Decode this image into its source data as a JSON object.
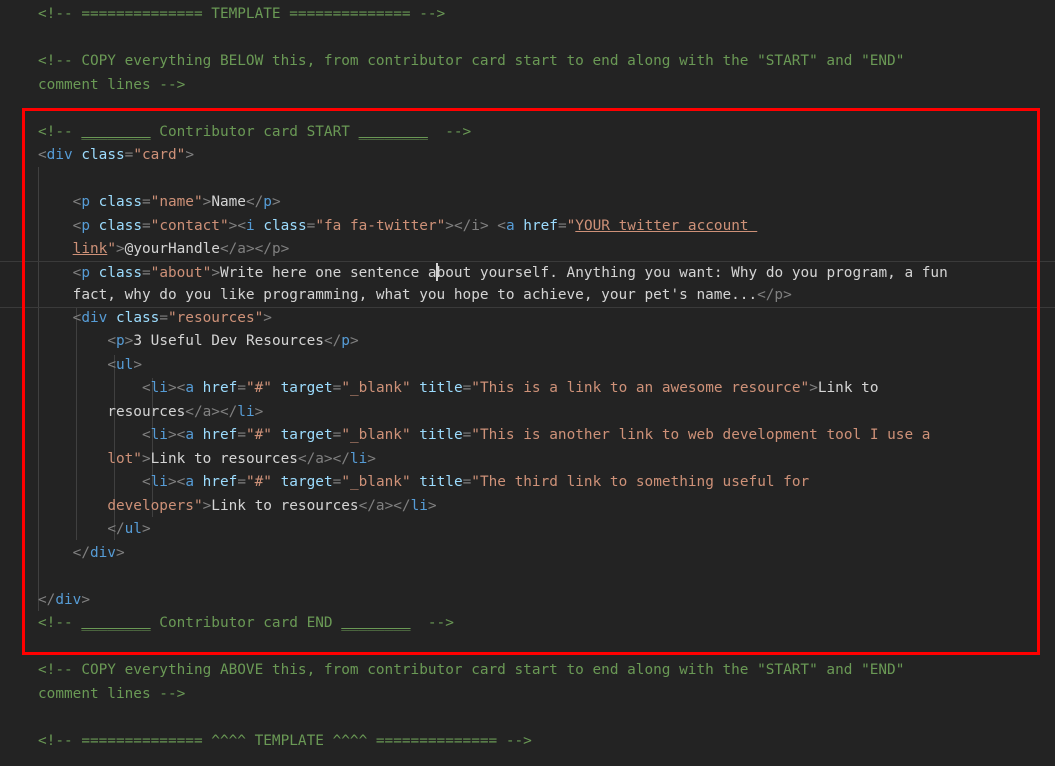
{
  "editor": {
    "background_color": "#232323",
    "default_text_color": "#d4d4d4",
    "comment_color": "#6a9955",
    "tag_color": "#569cd6",
    "attribute_color": "#9cdcfe",
    "string_color": "#ce9178",
    "punctuation_color": "#808080",
    "annotation_box_color": "#ff0000",
    "current_line_border_color": "#3a3a3a"
  },
  "lines": {
    "l1_template_header": "<!-- ============== TEMPLATE ============== -->",
    "l3_copy_below_a": "<!-- COPY everything BELOW this, from contributor card start to end along with the \"START\" and \"END\"",
    "l3_copy_below_b": "comment lines -->",
    "l5_card_start_pre": "<!-- ",
    "l5_card_start_u1": "________",
    "l5_card_start_mid": " Contributor card START ",
    "l5_card_start_u2": "________",
    "l5_card_start_post": "  -->",
    "l6_div_open_p1": "<",
    "l6_div_open_tag": "div",
    "l6_div_open_attr": " class",
    "l6_div_open_eq": "=",
    "l6_div_open_str": "\"card\"",
    "l6_div_open_p2": ">",
    "l8_name_indent": "    ",
    "l8_p_open": "<",
    "l8_p_tag": "p",
    "l8_p_attr": " class",
    "l8_p_eq": "=",
    "l8_p_str": "\"name\"",
    "l8_p_gt": ">",
    "l8_p_text": "Name",
    "l8_p_close": "</",
    "l8_p_closetag": "p",
    "l8_p_closegt": ">",
    "l9_contact_p_str": "\"contact\"",
    "l9_i_open": "<",
    "l9_i_tag": "i",
    "l9_i_attr": " class",
    "l9_i_str": "\"fa fa-twitter\"",
    "l9_i_close": "</i>",
    "l9_a_open": "<",
    "l9_a_tag": "a",
    "l9_a_attr": " href",
    "l9_a_str_open": "\"",
    "l9_a_href_value_part1": "YOUR twitter account ",
    "l9_a_href_value_part2": "link",
    "l9_a_str_close": "\"",
    "l9_a_gt": ">",
    "l9_a_text": "@yourHandle",
    "l9_a_close": "</a>",
    "l9_p_close": "</p>",
    "l10_about_str": "\"about\"",
    "l10_about_text_a": "Write here one sentence a",
    "l10_about_text_b": "bout yourself. Anything you want: Why do you program, a fun",
    "l10_about_text_c": "fact, why do you like programming, what you hope to achieve, your pet's name...",
    "l10_about_close": "</p>",
    "l11_div_resources_str": "\"resources\"",
    "l12_p3_text": "3 Useful Dev Resources",
    "l13_ul_tag": "ul",
    "l14_li_tag": "li",
    "l14_href_str": "\"#\"",
    "l14_target_attr": " target",
    "l14_target_str": "\"_blank\"",
    "l14_title_attr": " title",
    "l14_title_str_1": "\"This is a link to an awesome resource\"",
    "l14_link_text_1a": "Link to",
    "l14_link_text_1b": "resources",
    "l15_title_str_2": "\"This is another link to web development tool I use a",
    "l15_title_str_2b": "lot\"",
    "l15_link_text_2": "Link to resources",
    "l16_title_str_3": "\"The third link to something useful for",
    "l16_title_str_3b": "developers\"",
    "l16_link_text_3": "Link to resources",
    "l17_ul_close": "</ul>",
    "l18_div_close_inner": "</div>",
    "l20_div_close_outer": "</div>",
    "l21_card_end_pre": "<!-- ",
    "l21_card_end_u1": "________",
    "l21_card_end_mid": " Contributor card END ",
    "l21_card_end_u2": "________",
    "l21_card_end_post": "  -->",
    "l23_copy_above_a": "<!-- COPY everything ABOVE this, from contributor card start to end along with the \"START\" and \"END\"",
    "l23_copy_above_b": "comment lines -->",
    "l25_template_footer": "<!-- ============== ^^^^ TEMPLATE ^^^^ ============== -->"
  },
  "tokens": {
    "lt": "<",
    "gt": ">",
    "close_lt": "</",
    "eq": "=",
    "a_tag": "a",
    "p_tag": "p",
    "i_tag": "i",
    "li_tag": "li",
    "ul_tag": "ul",
    "div_tag": "div",
    "class_attr": " class",
    "href_attr": " href",
    "indent4": "    ",
    "indent8": "        ",
    "indent12": "            ",
    "indent16": "                ",
    "indent20": "                    "
  }
}
